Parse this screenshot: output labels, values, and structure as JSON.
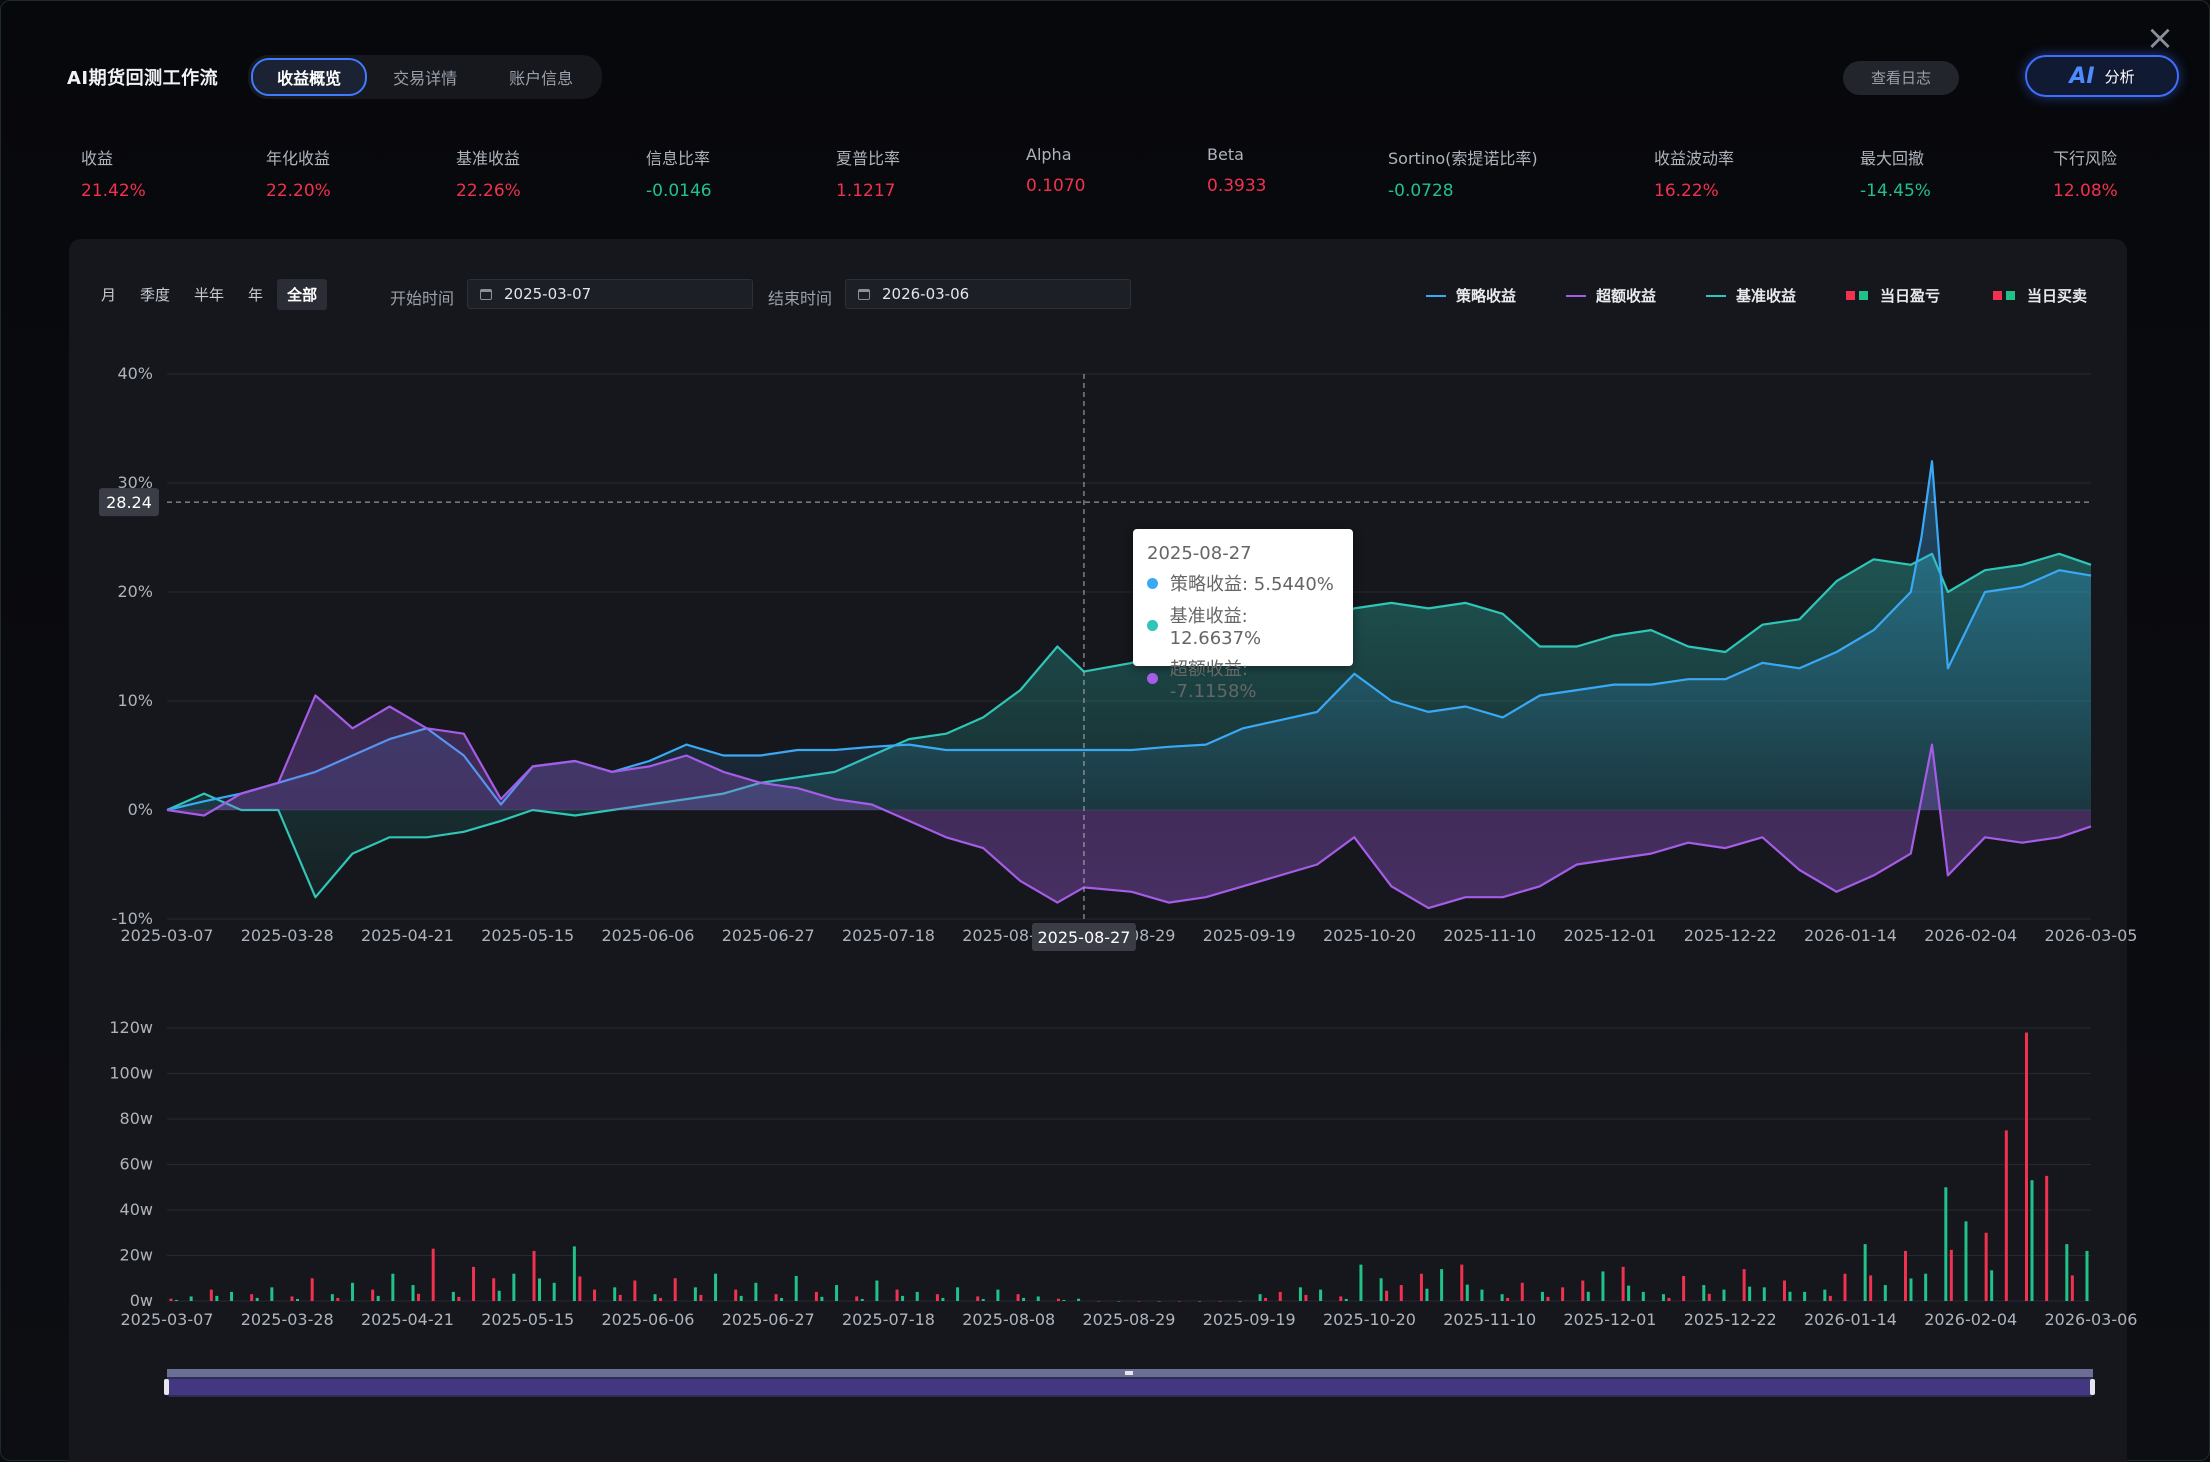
{
  "app": {
    "title": "AI期货回测工作流",
    "tabs": [
      "收益概览",
      "交易详情",
      "账户信息"
    ],
    "active_tab": 0,
    "log_button": "查看日志",
    "ai_button_glyph": "AI",
    "ai_button_label": "分析"
  },
  "metrics": [
    {
      "label": "收益",
      "value": "21.42%",
      "tone": "red"
    },
    {
      "label": "年化收益",
      "value": "22.20%",
      "tone": "red"
    },
    {
      "label": "基准收益",
      "value": "22.26%",
      "tone": "red"
    },
    {
      "label": "信息比率",
      "value": "-0.0146",
      "tone": "green"
    },
    {
      "label": "夏普比率",
      "value": "1.1217",
      "tone": "red"
    },
    {
      "label": "Alpha",
      "value": "0.1070",
      "tone": "red"
    },
    {
      "label": "Beta",
      "value": "0.3933",
      "tone": "red"
    },
    {
      "label": "Sortino(索提诺比率)",
      "value": "-0.0728",
      "tone": "green"
    },
    {
      "label": "收益波动率",
      "value": "16.22%",
      "tone": "red"
    },
    {
      "label": "最大回撤",
      "value": "-14.45%",
      "tone": "green"
    },
    {
      "label": "下行风险",
      "value": "12.08%",
      "tone": "red"
    }
  ],
  "controls": {
    "periods": [
      "月",
      "季度",
      "半年",
      "年",
      "全部"
    ],
    "active_period": 4,
    "start_label": "开始时间",
    "start_date": "2025-03-07",
    "end_label": "结束时间",
    "end_date": "2026-03-06"
  },
  "legend": [
    {
      "label": "策略收益",
      "kind": "line",
      "color": "#3aa9f5"
    },
    {
      "label": "超额收益",
      "kind": "line",
      "color": "#a55ce6"
    },
    {
      "label": "基准收益",
      "kind": "line",
      "color": "#2fc6b8"
    },
    {
      "label": "当日盈亏",
      "kind": "squares",
      "colors": [
        "#f0314f",
        "#21c18a"
      ]
    },
    {
      "label": "当日买卖",
      "kind": "squares",
      "colors": [
        "#f0314f",
        "#21c18a"
      ]
    }
  ],
  "colors": {
    "strategy": "#3aa9f5",
    "excess": "#a55ce6",
    "benchmark": "#2fc6b8",
    "up": "#f0314f",
    "down": "#21c18a"
  },
  "tooltip": {
    "date": "2025-08-27",
    "rows": [
      {
        "label": "策略收益: 5.5440%",
        "color": "#3aa9f5"
      },
      {
        "label": "基准收益: 12.6637%",
        "color": "#2fc6b8"
      },
      {
        "label": "超额收益: -7.1158%",
        "color": "#a55ce6"
      }
    ],
    "crosshair_y_label": "28.24",
    "crosshair_x_label": "2025-08-27"
  },
  "chart_data": [
    {
      "type": "line",
      "ylim": [
        -10,
        40
      ],
      "y_ticks": [
        "-10%",
        "0%",
        "10%",
        "20%",
        "30%",
        "40%"
      ],
      "x_ticks": [
        "2025-03-07",
        "2025-03-28",
        "2025-04-21",
        "2025-05-15",
        "2025-06-06",
        "2025-06-27",
        "2025-07-18",
        "2025-08-08",
        "2025-08-29",
        "2025-09-19",
        "2025-10-20",
        "2025-11-10",
        "2025-12-01",
        "2025-12-22",
        "2026-01-14",
        "2026-02-04",
        "2026-03-05"
      ],
      "series": [
        {
          "name": "策略收益",
          "color": "#3aa9f5",
          "x": [
            "2025-03-07",
            "2025-03-14",
            "2025-03-21",
            "2025-03-28",
            "2025-04-04",
            "2025-04-11",
            "2025-04-18",
            "2025-04-25",
            "2025-05-02",
            "2025-05-09",
            "2025-05-15",
            "2025-05-23",
            "2025-05-30",
            "2025-06-06",
            "2025-06-13",
            "2025-06-20",
            "2025-06-27",
            "2025-07-04",
            "2025-07-11",
            "2025-07-18",
            "2025-07-25",
            "2025-08-01",
            "2025-08-08",
            "2025-08-15",
            "2025-08-22",
            "2025-08-27",
            "2025-09-05",
            "2025-09-12",
            "2025-09-19",
            "2025-09-26",
            "2025-10-10",
            "2025-10-17",
            "2025-10-24",
            "2025-10-31",
            "2025-11-07",
            "2025-11-14",
            "2025-11-21",
            "2025-11-28",
            "2025-12-05",
            "2025-12-12",
            "2025-12-19",
            "2025-12-26",
            "2026-01-02",
            "2026-01-09",
            "2026-01-16",
            "2026-01-23",
            "2026-01-30",
            "2026-02-01",
            "2026-02-03",
            "2026-02-06",
            "2026-02-13",
            "2026-02-20",
            "2026-02-27",
            "2026-03-05"
          ],
          "values": [
            0.0,
            0.8,
            1.5,
            2.5,
            3.5,
            5.0,
            6.5,
            7.5,
            5.0,
            0.5,
            4.0,
            4.5,
            3.5,
            4.5,
            6.0,
            5.0,
            5.0,
            5.5,
            5.5,
            5.8,
            6.0,
            5.5,
            5.5,
            5.5,
            5.5,
            5.5,
            5.5,
            5.8,
            6.0,
            7.5,
            9.0,
            12.5,
            10.0,
            9.0,
            9.5,
            8.5,
            10.5,
            11.0,
            11.5,
            11.5,
            12.0,
            12.0,
            13.5,
            13.0,
            14.5,
            16.5,
            20.0,
            25.0,
            32.0,
            13.0,
            20.0,
            20.5,
            22.0,
            21.5
          ]
        },
        {
          "name": "基准收益",
          "color": "#2fc6b8",
          "x": [
            "2025-03-07",
            "2025-03-14",
            "2025-03-21",
            "2025-03-28",
            "2025-04-04",
            "2025-04-11",
            "2025-04-18",
            "2025-04-25",
            "2025-05-02",
            "2025-05-09",
            "2025-05-15",
            "2025-05-23",
            "2025-05-30",
            "2025-06-06",
            "2025-06-13",
            "2025-06-20",
            "2025-06-27",
            "2025-07-04",
            "2025-07-11",
            "2025-07-18",
            "2025-07-25",
            "2025-08-01",
            "2025-08-08",
            "2025-08-15",
            "2025-08-22",
            "2025-08-27",
            "2025-09-05",
            "2025-09-12",
            "2025-09-19",
            "2025-09-26",
            "2025-10-10",
            "2025-10-17",
            "2025-10-24",
            "2025-10-31",
            "2025-11-07",
            "2025-11-14",
            "2025-11-21",
            "2025-11-28",
            "2025-12-05",
            "2025-12-12",
            "2025-12-19",
            "2025-12-26",
            "2026-01-02",
            "2026-01-09",
            "2026-01-16",
            "2026-01-23",
            "2026-01-30",
            "2026-02-01",
            "2026-02-03",
            "2026-02-06",
            "2026-02-13",
            "2026-02-20",
            "2026-02-27",
            "2026-03-05"
          ],
          "values": [
            0.0,
            1.5,
            0.0,
            0.0,
            -8.0,
            -4.0,
            -2.5,
            -2.5,
            -2.0,
            -1.0,
            0.0,
            -0.5,
            0.0,
            0.5,
            1.0,
            1.5,
            2.5,
            3.0,
            3.5,
            5.0,
            6.5,
            7.0,
            8.5,
            11.0,
            15.0,
            12.7,
            13.5,
            15.0,
            16.0,
            17.0,
            17.5,
            18.5,
            19.0,
            18.5,
            19.0,
            18.0,
            15.0,
            15.0,
            16.0,
            16.5,
            15.0,
            14.5,
            17.0,
            17.5,
            21.0,
            23.0,
            22.5,
            23.0,
            23.5,
            20.0,
            22.0,
            22.5,
            23.5,
            22.5
          ]
        },
        {
          "name": "超额收益",
          "color": "#a55ce6",
          "x": [
            "2025-03-07",
            "2025-03-14",
            "2025-03-21",
            "2025-03-28",
            "2025-04-04",
            "2025-04-11",
            "2025-04-18",
            "2025-04-25",
            "2025-05-02",
            "2025-05-09",
            "2025-05-15",
            "2025-05-23",
            "2025-05-30",
            "2025-06-06",
            "2025-06-13",
            "2025-06-20",
            "2025-06-27",
            "2025-07-04",
            "2025-07-11",
            "2025-07-18",
            "2025-07-25",
            "2025-08-01",
            "2025-08-08",
            "2025-08-15",
            "2025-08-22",
            "2025-08-27",
            "2025-09-05",
            "2025-09-12",
            "2025-09-19",
            "2025-09-26",
            "2025-10-10",
            "2025-10-17",
            "2025-10-24",
            "2025-10-31",
            "2025-11-07",
            "2025-11-14",
            "2025-11-21",
            "2025-11-28",
            "2025-12-05",
            "2025-12-12",
            "2025-12-19",
            "2025-12-26",
            "2026-01-02",
            "2026-01-09",
            "2026-01-16",
            "2026-01-23",
            "2026-01-30",
            "2026-02-01",
            "2026-02-03",
            "2026-02-06",
            "2026-02-13",
            "2026-02-20",
            "2026-02-27",
            "2026-03-05"
          ],
          "values": [
            0.0,
            -0.5,
            1.5,
            2.5,
            10.5,
            7.5,
            9.5,
            7.5,
            7.0,
            1.0,
            4.0,
            4.5,
            3.5,
            4.0,
            5.0,
            3.5,
            2.5,
            2.0,
            1.0,
            0.5,
            -1.0,
            -2.5,
            -3.5,
            -6.5,
            -8.5,
            -7.1,
            -7.5,
            -8.5,
            -8.0,
            -7.0,
            -5.0,
            -2.5,
            -7.0,
            -9.0,
            -8.0,
            -8.0,
            -7.0,
            -5.0,
            -4.5,
            -4.0,
            -3.0,
            -3.5,
            -2.5,
            -5.5,
            -7.5,
            -6.0,
            -4.0,
            1.0,
            6.0,
            -6.0,
            -2.5,
            -3.0,
            -2.5,
            -1.5
          ]
        }
      ]
    },
    {
      "type": "bar",
      "ylim": [
        0,
        120
      ],
      "y_ticks": [
        "0w",
        "20w",
        "40w",
        "60w",
        "80w",
        "100w",
        "120w"
      ],
      "x_ticks": [
        "2025-03-07",
        "2025-03-28",
        "2025-04-21",
        "2025-05-15",
        "2025-06-06",
        "2025-06-27",
        "2025-07-18",
        "2025-08-08",
        "2025-08-29",
        "2025-09-19",
        "2025-10-20",
        "2025-11-10",
        "2025-12-01",
        "2025-12-22",
        "2026-01-14",
        "2026-02-04",
        "2026-03-06"
      ],
      "bars_ratio": [
        0.0,
        0.01,
        0.02,
        0.03,
        0.04,
        0.05,
        0.06,
        0.07,
        0.08,
        0.09,
        0.1,
        0.11,
        0.12,
        0.13,
        0.14,
        0.15,
        0.16,
        0.17,
        0.18,
        0.19,
        0.2,
        0.21,
        0.22,
        0.23,
        0.24,
        0.25,
        0.26,
        0.27,
        0.28,
        0.29,
        0.3,
        0.31,
        0.32,
        0.33,
        0.34,
        0.35,
        0.36,
        0.37,
        0.38,
        0.39,
        0.4,
        0.41,
        0.42,
        0.43,
        0.44,
        0.45,
        0.46,
        0.47,
        0.48,
        0.49,
        0.5,
        0.51,
        0.52,
        0.53,
        0.54,
        0.55,
        0.56,
        0.57,
        0.58,
        0.59,
        0.6,
        0.61,
        0.62,
        0.63,
        0.64,
        0.65,
        0.66,
        0.67,
        0.68,
        0.69,
        0.7,
        0.71,
        0.72,
        0.73,
        0.74,
        0.75,
        0.76,
        0.77,
        0.78,
        0.79,
        0.8,
        0.81,
        0.82,
        0.83,
        0.84,
        0.85,
        0.86,
        0.87,
        0.88,
        0.89,
        0.9,
        0.91,
        0.92,
        0.93,
        0.94,
        0.95
      ],
      "values": [
        1,
        2,
        5,
        4,
        3,
        6,
        2,
        10,
        3,
        8,
        5,
        12,
        7,
        23,
        4,
        15,
        10,
        12,
        22,
        8,
        24,
        5,
        6,
        9,
        3,
        10,
        6,
        12,
        5,
        8,
        3,
        11,
        4,
        7,
        2,
        9,
        5,
        4,
        3,
        6,
        2,
        5,
        3,
        2,
        1,
        1,
        0,
        0,
        0,
        0,
        0,
        0,
        0,
        0,
        3,
        4,
        6,
        5,
        2,
        16,
        10,
        7,
        12,
        14,
        16,
        5,
        3,
        8,
        4,
        6,
        9,
        13,
        15,
        4,
        3,
        11,
        7,
        5,
        14,
        6,
        9,
        4,
        5,
        12,
        25,
        7,
        22,
        12,
        50,
        35,
        30,
        75,
        118,
        55,
        25,
        22
      ],
      "signs": [
        "up",
        "down",
        "up",
        "down",
        "up",
        "down",
        "up",
        "up",
        "down",
        "down",
        "up",
        "down",
        "down",
        "up",
        "down",
        "up",
        "up",
        "down",
        "up",
        "down",
        "down",
        "up",
        "down",
        "up",
        "down",
        "up",
        "down",
        "down",
        "up",
        "down",
        "up",
        "down",
        "up",
        "down",
        "up",
        "down",
        "up",
        "down",
        "up",
        "down",
        "up",
        "down",
        "up",
        "down",
        "up",
        "down",
        "up",
        "down",
        "up",
        "down",
        "up",
        "down",
        "up",
        "down",
        "down",
        "up",
        "down",
        "down",
        "up",
        "down",
        "down",
        "up",
        "up",
        "down",
        "up",
        "down",
        "down",
        "up",
        "down",
        "up",
        "up",
        "down",
        "up",
        "down",
        "down",
        "up",
        "down",
        "down",
        "up",
        "down",
        "up",
        "down",
        "down",
        "up",
        "down",
        "down",
        "up",
        "down",
        "down",
        "down",
        "up",
        "up",
        "up",
        "up",
        "down",
        "down"
      ]
    }
  ]
}
